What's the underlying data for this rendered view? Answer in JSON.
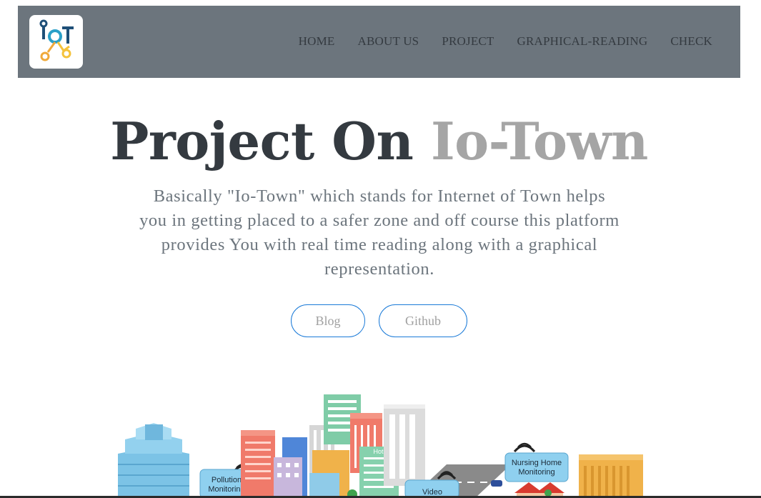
{
  "navbar": {
    "logo_text": "IoT",
    "links": [
      "HOME",
      "ABOUT US",
      "PROJECT",
      "GRAPHICAL-READING",
      "CHECK"
    ]
  },
  "hero": {
    "title_main": "Project On ",
    "title_accent": "Io-Town",
    "description": "Basically \"Io-Town\" which stands for Internet of Town helps you in getting placed to a safer zone and off course this platform provides You with real time reading along with a graphical representation.",
    "buttons": {
      "blog": "Blog",
      "github": "Github"
    }
  },
  "illustration": {
    "labels": {
      "pollution": "Pollution Monitoring",
      "hotel": "Hotel",
      "video": "Video",
      "nursing": "Nursing Home Monitoring"
    }
  },
  "colors": {
    "navbar_bg": "#6c757d",
    "title_dark": "#343a40",
    "title_accent": "#a5a5a5",
    "button_border": "#1a7ad8"
  }
}
